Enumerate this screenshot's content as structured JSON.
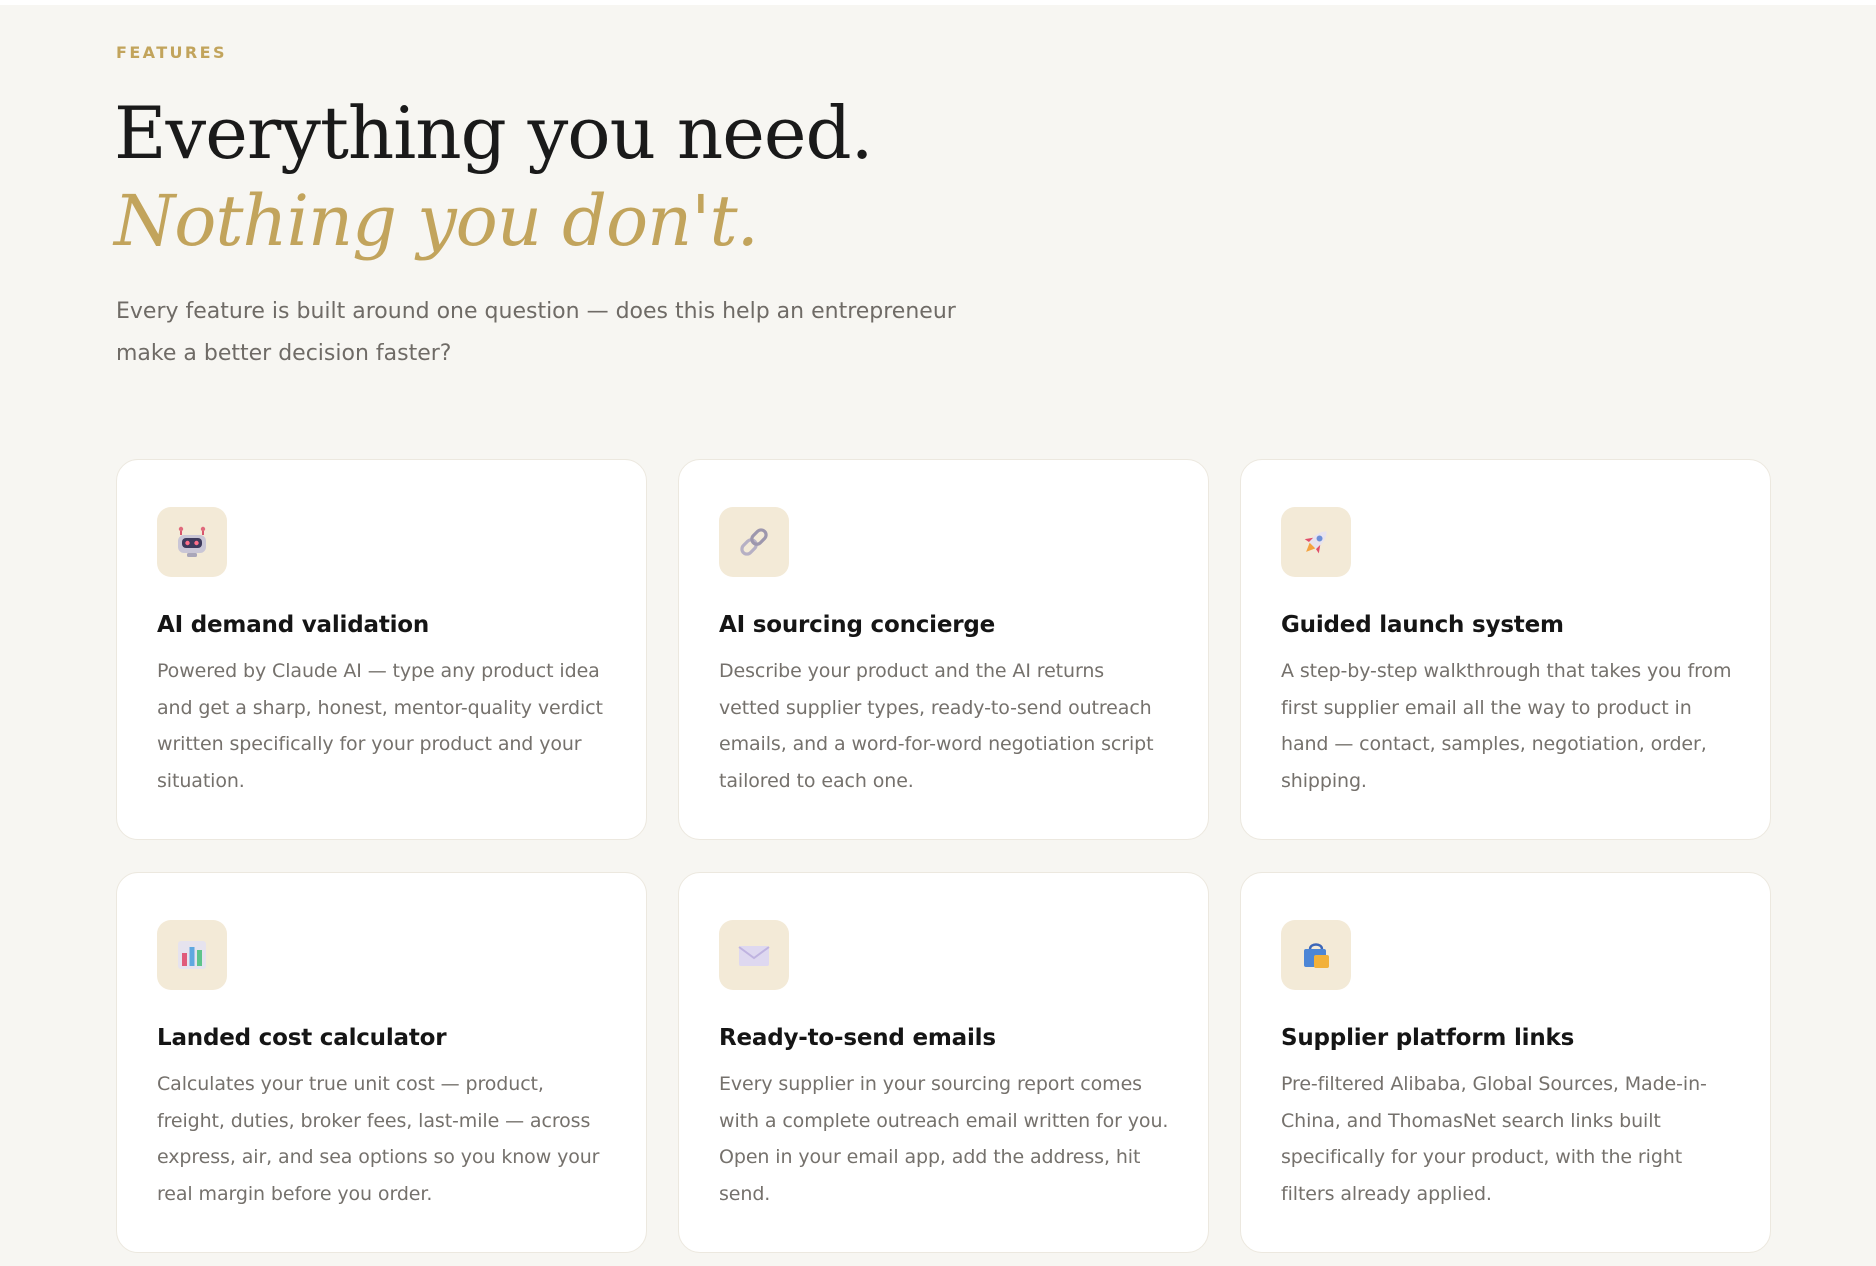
{
  "section": {
    "eyebrow": "FEATURES",
    "headline": "Everything you need.",
    "headline_accent": "Nothing you don't.",
    "intro": "Every feature is built around one question — does this help an entrepreneur make a better decision faster?"
  },
  "colors": {
    "accent": "#c2a45c",
    "background": "#f7f6f2",
    "card": "#ffffff",
    "icon_tile": "#f3ead7"
  },
  "features": [
    {
      "icon": "robot-icon",
      "title": "AI demand validation",
      "description": "Powered by Claude AI — type any product idea and get a sharp, honest, mentor-quality verdict written specifically for your product and your situation."
    },
    {
      "icon": "link-icon",
      "title": "AI sourcing concierge",
      "description": "Describe your product and the AI returns vetted supplier types, ready-to-send outreach emails, and a word-for-word negotiation script tailored to each one."
    },
    {
      "icon": "rocket-icon",
      "title": "Guided launch system",
      "description": "A step-by-step walkthrough that takes you from first supplier email all the way to product in hand — contact, samples, negotiation, order, shipping."
    },
    {
      "icon": "bar-chart-icon",
      "title": "Landed cost calculator",
      "description": "Calculates your true unit cost — product, freight, duties, broker fees, last-mile — across express, air, and sea options so you know your real margin before you order."
    },
    {
      "icon": "envelope-icon",
      "title": "Ready-to-send emails",
      "description": "Every supplier in your sourcing report comes with a complete outreach email written for you. Open in your email app, add the address, hit send."
    },
    {
      "icon": "shopping-bag-icon",
      "title": "Supplier platform links",
      "description": "Pre-filtered Alibaba, Global Sources, Made-in-China, and ThomasNet search links built specifically for your product, with the right filters already applied."
    }
  ]
}
